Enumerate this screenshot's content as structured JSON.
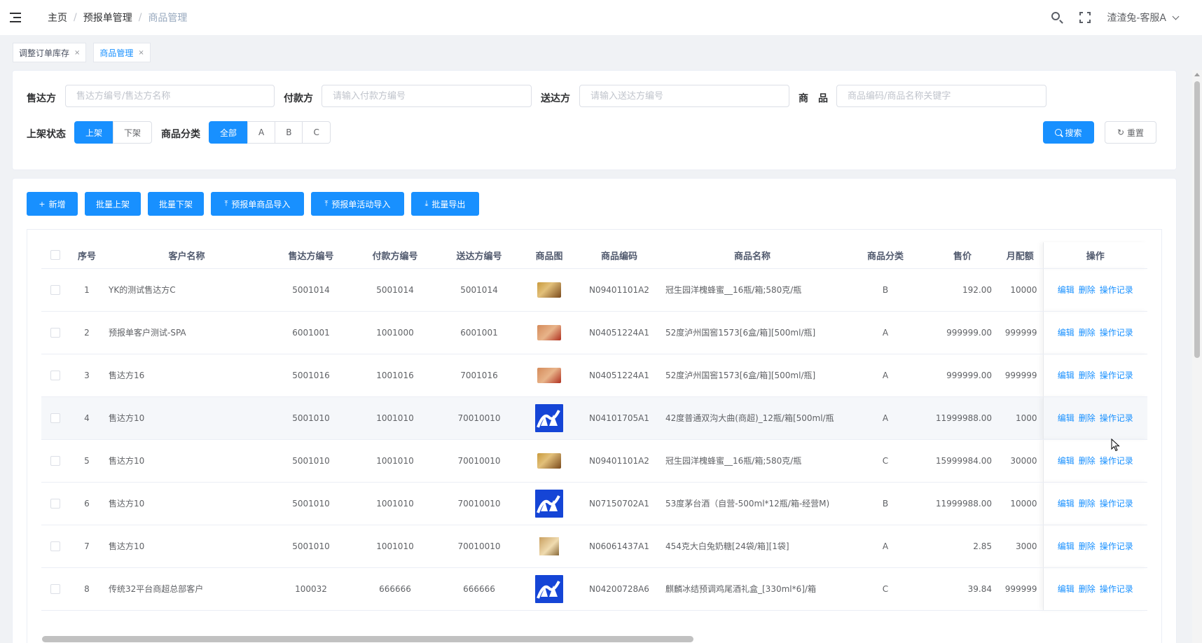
{
  "header": {
    "breadcrumb": [
      "主页",
      "预报单管理",
      "商品管理"
    ],
    "user": "渣渣兔-客服A"
  },
  "tags": [
    {
      "label": "调整订单库存",
      "close": "×"
    },
    {
      "label": "商品管理",
      "close": "×"
    }
  ],
  "filters": {
    "seller_label": "售达方",
    "seller_placeholder": "售达方编号/售达方名称",
    "payer_label": "付款方",
    "payer_placeholder": "请输入付款方编号",
    "shipto_label": "送达方",
    "shipto_placeholder": "请输入送达方编号",
    "product_label": "商　品",
    "product_placeholder": "商品编码/商品名称关键字",
    "status_label": "上架状态",
    "status_options": [
      "上架",
      "下架"
    ],
    "status_selected": "上架",
    "category_label": "商品分类",
    "category_options": [
      "全部",
      "A",
      "B",
      "C"
    ],
    "category_selected": "全部",
    "search_label": "搜索",
    "reset_label": "重置"
  },
  "toolbar": {
    "add": "新增",
    "batch_on": "批量上架",
    "batch_off": "批量下架",
    "import_goods": "预报单商品导入",
    "import_activity": "预报单活动导入",
    "batch_export": "批量导出"
  },
  "table": {
    "headers": [
      "序号",
      "客户名称",
      "售达方编号",
      "付款方编号",
      "送达方编号",
      "商品图",
      "商品编码",
      "商品名称",
      "商品分类",
      "售价",
      "月配额",
      "操作"
    ],
    "actions": [
      "编辑",
      "删除",
      "操作记录"
    ],
    "rows": [
      {
        "no": "1",
        "customer": "YK的测试售达方C",
        "seller": "5001014",
        "payer": "5001014",
        "shipto": "5001014",
        "img": "honey",
        "code": "N09401101A2",
        "name": "冠生园洋槐蜂蜜__16瓶/箱;580克/瓶",
        "cat": "B",
        "price": "192.00",
        "quota": "10000"
      },
      {
        "no": "2",
        "customer": "预报单客户测试-SPA",
        "seller": "6001001",
        "payer": "1001000",
        "shipto": "6001001",
        "img": "baijiu",
        "code": "N04051224A1",
        "name": "52度泸州国窖1573[6盒/箱][500ml/瓶]",
        "cat": "A",
        "price": "999999.00",
        "quota": "999999"
      },
      {
        "no": "3",
        "customer": "售达方16",
        "seller": "5001016",
        "payer": "1001016",
        "shipto": "7001016",
        "img": "baijiu",
        "code": "N04051224A1",
        "name": "52度泸州国窖1573[6盒/箱][500ml/瓶]",
        "cat": "A",
        "price": "999999.00",
        "quota": "999999"
      },
      {
        "no": "4",
        "customer": "售达方10",
        "seller": "5001010",
        "payer": "1001010",
        "shipto": "70010010",
        "img": "logo",
        "code": "N04101705A1",
        "name": "42度普通双沟大曲(商超)_12瓶/箱[500ml/瓶",
        "cat": "A",
        "price": "11999988.00",
        "quota": "1000"
      },
      {
        "no": "5",
        "customer": "售达方10",
        "seller": "5001010",
        "payer": "1001010",
        "shipto": "70010010",
        "img": "honey",
        "code": "N09401101A2",
        "name": "冠生园洋槐蜂蜜__16瓶/箱;580克/瓶",
        "cat": "C",
        "price": "15999984.00",
        "quota": "30000"
      },
      {
        "no": "6",
        "customer": "售达方10",
        "seller": "5001010",
        "payer": "1001010",
        "shipto": "70010010",
        "img": "logo",
        "code": "N07150702A1",
        "name": "53度茅台酒（自营-500ml*12瓶/箱-经营M)",
        "cat": "B",
        "price": "11999988.00",
        "quota": "10000"
      },
      {
        "no": "7",
        "customer": "售达方10",
        "seller": "5001010",
        "payer": "1001010",
        "shipto": "70010010",
        "img": "candy",
        "code": "N06061437A1",
        "name": "454克大白兔奶糖[24袋/箱][1袋]",
        "cat": "A",
        "price": "2.85",
        "quota": "3000"
      },
      {
        "no": "8",
        "customer": "传统32平台商超总部客户",
        "seller": "100032",
        "payer": "666666",
        "shipto": "666666",
        "img": "logo",
        "code": "N04200728A6",
        "name": "麒麟冰结预调鸡尾酒礼盒_[330ml*6]/箱",
        "cat": "C",
        "price": "39.84",
        "quota": "999999"
      }
    ]
  },
  "icons": {
    "menu": "hamburger-icon",
    "search": "search-icon",
    "fullscreen": "fullscreen-icon",
    "dropdown": "chevron-down-icon"
  },
  "colors": {
    "primary": "#1890ff",
    "logo_blue": "#1545d6"
  }
}
